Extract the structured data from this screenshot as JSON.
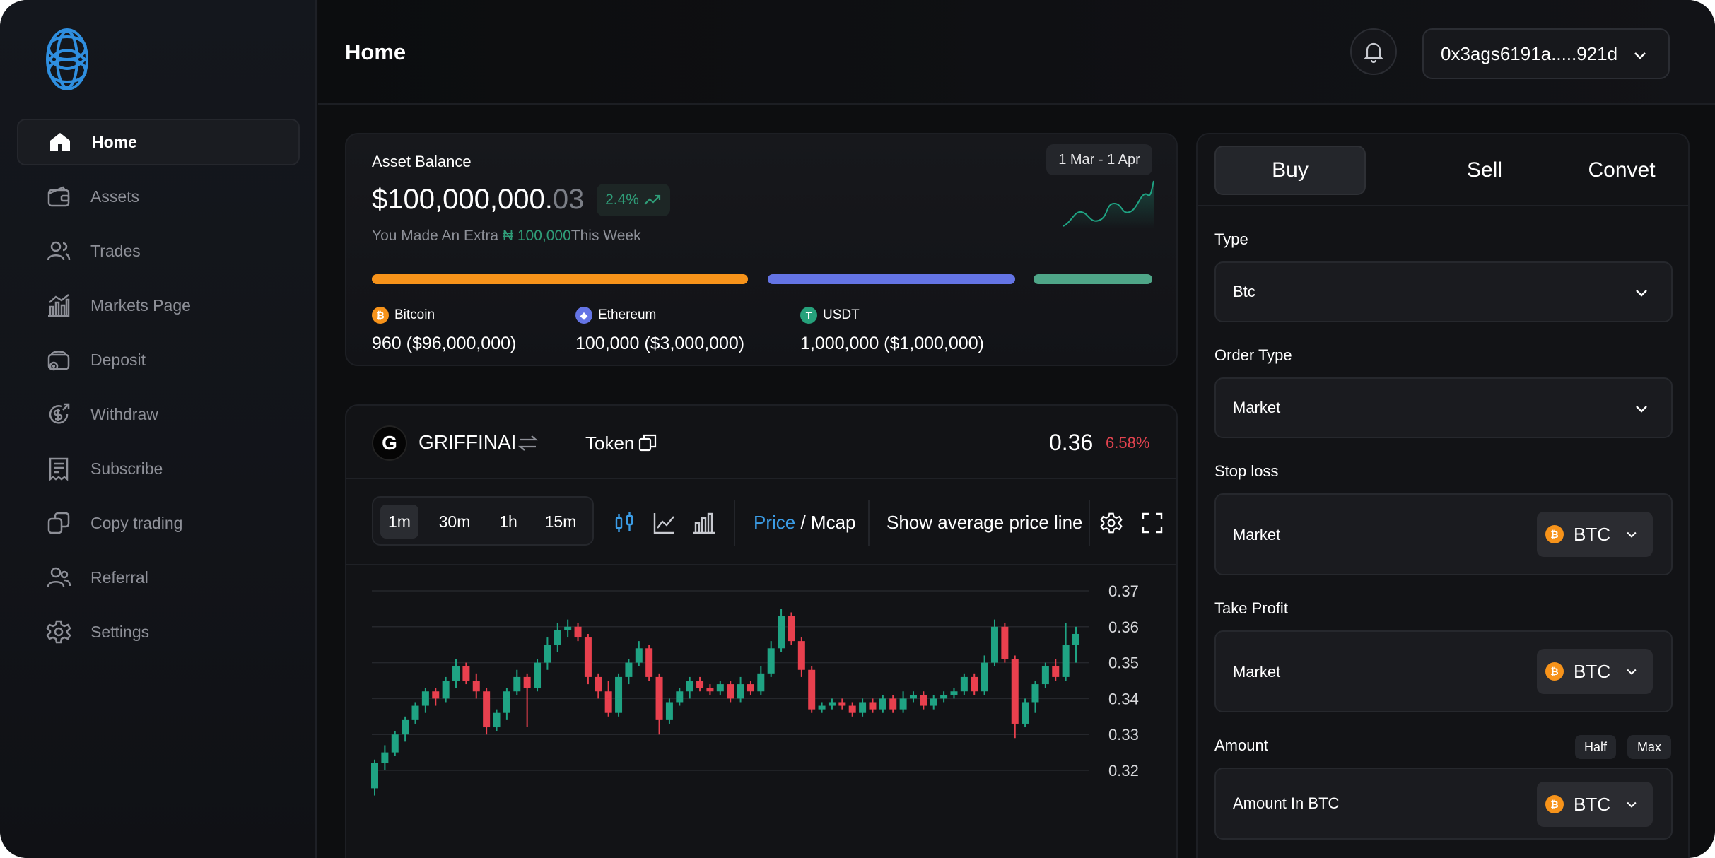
{
  "header": {
    "title": "Home",
    "wallet_address": "0x3ags6191a.....921d"
  },
  "sidebar": {
    "items": [
      {
        "label": "Home",
        "icon": "home-icon"
      },
      {
        "label": "Assets",
        "icon": "wallet-icon"
      },
      {
        "label": "Trades",
        "icon": "users-icon"
      },
      {
        "label": "Markets Page",
        "icon": "chart-icon"
      },
      {
        "label": "Deposit",
        "icon": "deposit-icon"
      },
      {
        "label": "Withdraw",
        "icon": "withdraw-icon"
      },
      {
        "label": "Subscribe",
        "icon": "receipt-icon"
      },
      {
        "label": "Copy trading",
        "icon": "copy-icon"
      },
      {
        "label": "Referral",
        "icon": "referral-icon"
      },
      {
        "label": "Settings",
        "icon": "gear-icon"
      }
    ]
  },
  "balance": {
    "title": "Asset Balance",
    "amount_main": "$100,000,000.",
    "amount_decimals": "03",
    "change": "2.4%",
    "sub_prefix": "You Made An Extra ",
    "sub_amount": "₦ 100,000",
    "sub_suffix": "This Week",
    "date_range": "1 Mar - 1 Apr",
    "coins": [
      {
        "name": "Bitcoin",
        "symbol": "₿",
        "amount": "960",
        "value": "($96,000,000)",
        "color": "#f7931a"
      },
      {
        "name": "Ethereum",
        "symbol": "◆",
        "amount": "100,000",
        "value": "($3,000,000)",
        "color": "#6474e5"
      },
      {
        "name": "USDT",
        "symbol": "T",
        "amount": "1,000,000",
        "value": "($1,000,000)",
        "color": "#26a17b"
      }
    ]
  },
  "token": {
    "initial": "G",
    "name": "GRIFFINAI",
    "type": "Token",
    "price": "0.36",
    "change": "6.58%"
  },
  "toolbar": {
    "timeframes": [
      "1m",
      "30m",
      "1h",
      "15m"
    ],
    "price_label": "Price",
    "mcap_label": " / Mcap",
    "avg_line": "Show average price line"
  },
  "chart_data": {
    "type": "candlestick",
    "y_ticks": [
      "0.37",
      "0.36",
      "0.35",
      "0.34",
      "0.33",
      "0.32"
    ],
    "ylim": [
      0.315,
      0.375
    ],
    "candles": [
      [
        0.315,
        0.322,
        0.313,
        0.323
      ],
      [
        0.322,
        0.325,
        0.32,
        0.327
      ],
      [
        0.325,
        0.33,
        0.324,
        0.331
      ],
      [
        0.33,
        0.334,
        0.328,
        0.335
      ],
      [
        0.334,
        0.338,
        0.333,
        0.339
      ],
      [
        0.338,
        0.342,
        0.336,
        0.343
      ],
      [
        0.342,
        0.34,
        0.338,
        0.343
      ],
      [
        0.34,
        0.345,
        0.339,
        0.346
      ],
      [
        0.345,
        0.349,
        0.343,
        0.351
      ],
      [
        0.349,
        0.345,
        0.344,
        0.35
      ],
      [
        0.345,
        0.342,
        0.34,
        0.347
      ],
      [
        0.342,
        0.332,
        0.33,
        0.343
      ],
      [
        0.332,
        0.336,
        0.331,
        0.337
      ],
      [
        0.336,
        0.342,
        0.334,
        0.343
      ],
      [
        0.342,
        0.346,
        0.341,
        0.348
      ],
      [
        0.346,
        0.343,
        0.332,
        0.347
      ],
      [
        0.343,
        0.35,
        0.342,
        0.351
      ],
      [
        0.35,
        0.355,
        0.348,
        0.357
      ],
      [
        0.355,
        0.359,
        0.353,
        0.361
      ],
      [
        0.359,
        0.36,
        0.357,
        0.362
      ],
      [
        0.36,
        0.357,
        0.356,
        0.361
      ],
      [
        0.357,
        0.346,
        0.344,
        0.358
      ],
      [
        0.346,
        0.342,
        0.34,
        0.347
      ],
      [
        0.342,
        0.336,
        0.335,
        0.345
      ],
      [
        0.336,
        0.346,
        0.335,
        0.347
      ],
      [
        0.346,
        0.35,
        0.344,
        0.351
      ],
      [
        0.35,
        0.354,
        0.349,
        0.356
      ],
      [
        0.354,
        0.346,
        0.345,
        0.355
      ],
      [
        0.346,
        0.334,
        0.33,
        0.347
      ],
      [
        0.334,
        0.339,
        0.333,
        0.34
      ],
      [
        0.339,
        0.342,
        0.338,
        0.343
      ],
      [
        0.342,
        0.345,
        0.34,
        0.346
      ],
      [
        0.345,
        0.343,
        0.342,
        0.346
      ],
      [
        0.343,
        0.342,
        0.341,
        0.344
      ],
      [
        0.342,
        0.344,
        0.341,
        0.345
      ],
      [
        0.344,
        0.34,
        0.339,
        0.345
      ],
      [
        0.34,
        0.344,
        0.339,
        0.346
      ],
      [
        0.344,
        0.342,
        0.341,
        0.345
      ],
      [
        0.342,
        0.347,
        0.341,
        0.349
      ],
      [
        0.347,
        0.354,
        0.346,
        0.356
      ],
      [
        0.354,
        0.363,
        0.353,
        0.365
      ],
      [
        0.363,
        0.356,
        0.355,
        0.364
      ],
      [
        0.356,
        0.348,
        0.346,
        0.357
      ],
      [
        0.348,
        0.337,
        0.336,
        0.349
      ],
      [
        0.337,
        0.338,
        0.336,
        0.339
      ],
      [
        0.338,
        0.339,
        0.337,
        0.34
      ],
      [
        0.339,
        0.338,
        0.337,
        0.34
      ],
      [
        0.338,
        0.336,
        0.335,
        0.339
      ],
      [
        0.336,
        0.339,
        0.335,
        0.34
      ],
      [
        0.339,
        0.337,
        0.336,
        0.34
      ],
      [
        0.337,
        0.34,
        0.336,
        0.341
      ],
      [
        0.34,
        0.337,
        0.336,
        0.341
      ],
      [
        0.337,
        0.34,
        0.336,
        0.342
      ],
      [
        0.34,
        0.341,
        0.339,
        0.342
      ],
      [
        0.341,
        0.338,
        0.337,
        0.342
      ],
      [
        0.338,
        0.34,
        0.337,
        0.341
      ],
      [
        0.34,
        0.341,
        0.339,
        0.342
      ],
      [
        0.341,
        0.342,
        0.34,
        0.343
      ],
      [
        0.342,
        0.346,
        0.341,
        0.347
      ],
      [
        0.346,
        0.342,
        0.341,
        0.347
      ],
      [
        0.342,
        0.35,
        0.341,
        0.352
      ],
      [
        0.35,
        0.36,
        0.349,
        0.362
      ],
      [
        0.36,
        0.351,
        0.35,
        0.361
      ],
      [
        0.351,
        0.333,
        0.329,
        0.352
      ],
      [
        0.333,
        0.339,
        0.332,
        0.34
      ],
      [
        0.339,
        0.344,
        0.336,
        0.345
      ],
      [
        0.344,
        0.349,
        0.343,
        0.35
      ],
      [
        0.349,
        0.346,
        0.345,
        0.351
      ],
      [
        0.346,
        0.355,
        0.345,
        0.361
      ],
      [
        0.355,
        0.358,
        0.35,
        0.36
      ]
    ]
  },
  "trade": {
    "tabs": [
      "Buy",
      "Sell",
      "Convet"
    ],
    "type_label": "Type",
    "type_value": "Btc",
    "order_label": "Order Type",
    "order_value": "Market",
    "stop_label": "Stop loss",
    "stop_value": "Market",
    "take_label": "Take Profit",
    "take_value": "Market",
    "amount_label": "Amount",
    "amount_placeholder": "Amount In BTC",
    "half": "Half",
    "max": "Max",
    "coin": "BTC"
  },
  "colors": {
    "up": "#1fa383",
    "down": "#e8404e",
    "accent_blue": "#3b9ce5",
    "bitcoin": "#f7931a"
  }
}
